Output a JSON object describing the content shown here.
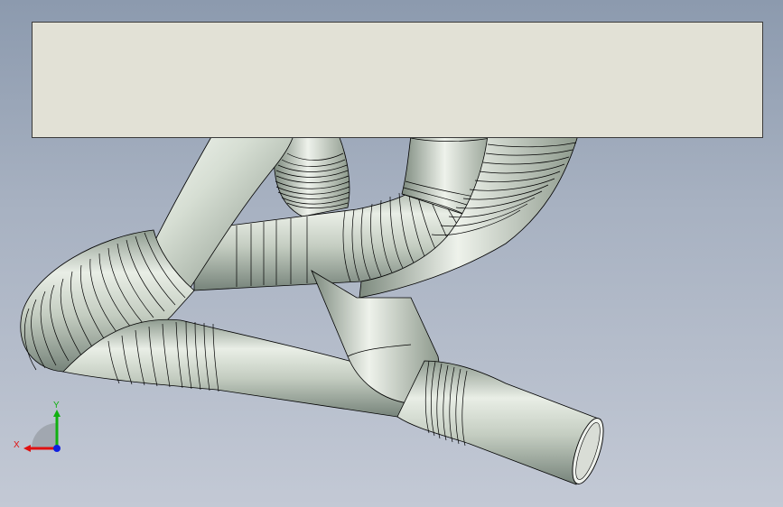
{
  "viewport": {
    "background_top": "#8c9aae",
    "background_bottom": "#c3c9d5",
    "pipe_color": "#cfd8cc",
    "pipe_shadow": "#8f9c90",
    "plate_color": "#e2e1d6",
    "edge_color": "#000000"
  },
  "triad": {
    "x_label": "X",
    "y_label": "Y",
    "x_color": "#e01010",
    "y_color": "#10b010",
    "z_color": "#1020e0"
  }
}
